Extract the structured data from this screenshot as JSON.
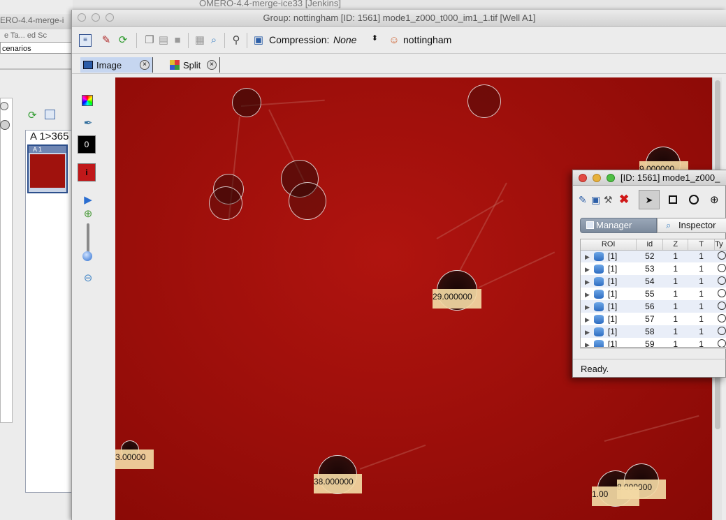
{
  "background_window": {
    "title": "OMERO-4.4-merge-ice33 [Jenkins]",
    "left_title_fragment": "ERO-4.4-merge-i",
    "menu_fragment": "e  Ta...  ed  Sc",
    "field_value": "cenarios",
    "plate_label": "A 1>365",
    "well_label": "A 1"
  },
  "main_window": {
    "title": "Group: nottingham [ID: 1561] mode1_z000_t000_im1_1.tif [Well A1]",
    "toolbar": {
      "compression_label": "Compression:",
      "compression_value": "None",
      "group_name": "nottingham"
    },
    "tabs": [
      {
        "label": "Image",
        "active": true
      },
      {
        "label": "Split",
        "active": false
      }
    ],
    "sidebar": {
      "channel_value": "0",
      "info_label": "i"
    },
    "roi_labels": [
      "29.000000",
      "3.00000",
      "38.000000",
      "8.000000",
      "1.00",
      "9.000000"
    ],
    "colors": {
      "image_bg": "#9a0e0a",
      "roi_label_bg": "#f3d9a4"
    }
  },
  "roi_window": {
    "title": "[ID: 1561] mode1_z000_",
    "tabs": [
      "Manager",
      "Inspector"
    ],
    "columns": [
      "ROI",
      "id",
      "Z",
      "T",
      "Ty"
    ],
    "rows": [
      {
        "roi": "[1]",
        "id": "52",
        "z": "1",
        "t": "1"
      },
      {
        "roi": "[1]",
        "id": "53",
        "z": "1",
        "t": "1"
      },
      {
        "roi": "[1]",
        "id": "54",
        "z": "1",
        "t": "1"
      },
      {
        "roi": "[1]",
        "id": "55",
        "z": "1",
        "t": "1"
      },
      {
        "roi": "[1]",
        "id": "56",
        "z": "1",
        "t": "1"
      },
      {
        "roi": "[1]",
        "id": "57",
        "z": "1",
        "t": "1"
      },
      {
        "roi": "[1]",
        "id": "58",
        "z": "1",
        "t": "1"
      },
      {
        "roi": "[1]",
        "id": "59",
        "z": "1",
        "t": "1"
      }
    ],
    "status": "Ready."
  }
}
